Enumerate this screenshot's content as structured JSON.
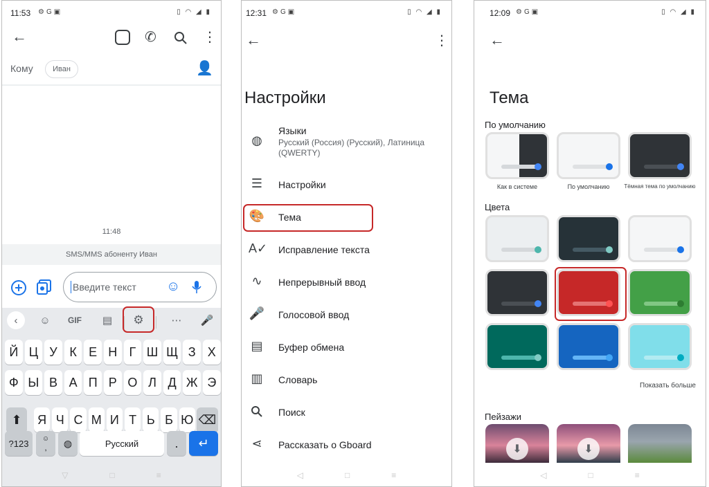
{
  "panel1": {
    "status_time": "11:53",
    "to_label": "Кому",
    "recipient_chip": "Иван",
    "message_time": "11:48",
    "sms_notice": "SMS/MMS абоненту Иван",
    "input_placeholder": "Введите текст",
    "gif_label": "GIF",
    "keyboard_rows": [
      [
        "Й",
        "Ц",
        "У",
        "К",
        "Е",
        "Н",
        "Г",
        "Ш",
        "Щ",
        "З",
        "Х"
      ],
      [
        "Ф",
        "Ы",
        "В",
        "А",
        "П",
        "Р",
        "О",
        "Л",
        "Д",
        "Ж",
        "Э"
      ],
      [
        "Я",
        "Ч",
        "С",
        "М",
        "И",
        "Т",
        "Ь",
        "Б",
        "Ю"
      ]
    ],
    "key_symbols": "?123",
    "key_space": "Русский",
    "key_period": ".",
    "emoji_small": "☺",
    "comma_small": ","
  },
  "panel2": {
    "status_time": "12:31",
    "title": "Настройки",
    "items": [
      {
        "label": "Языки",
        "sub": "Русский (Россия) (Русский), Латиница (QWERTY)",
        "icon": "globe-icon"
      },
      {
        "label": "Настройки",
        "icon": "tune-icon"
      },
      {
        "label": "Тема",
        "icon": "palette-icon"
      },
      {
        "label": "Исправление текста",
        "icon": "spellcheck-icon"
      },
      {
        "label": "Непрерывный ввод",
        "icon": "gesture-icon"
      },
      {
        "label": "Голосовой ввод",
        "icon": "mic-icon"
      },
      {
        "label": "Буфер обмена",
        "icon": "clipboard-icon"
      },
      {
        "label": "Словарь",
        "icon": "dictionary-icon"
      },
      {
        "label": "Поиск",
        "icon": "search-icon"
      },
      {
        "label": "Рассказать о Gboard",
        "icon": "share-icon"
      }
    ]
  },
  "panel3": {
    "status_time": "12:09",
    "title": "Тема",
    "section_default": "По умолчанию",
    "default_themes": [
      {
        "caption": "Как в системе"
      },
      {
        "caption": "По умолчанию"
      },
      {
        "caption": "Тёмная тема по умолчанию"
      }
    ],
    "section_colors": "Цвета",
    "show_more": "Показать больше",
    "section_landscapes": "Пейзажи",
    "color_themes": [
      {
        "bg": "#eceff1",
        "bar": "#d5d8db",
        "dot": "#4db6ac"
      },
      {
        "bg": "#263238",
        "bar": "#455a64",
        "dot": "#80cbc4"
      },
      {
        "bg": "#f5f6f7",
        "bar": "#dfe1e3",
        "dot": "#1a73e8"
      },
      {
        "bg": "#2f3337",
        "bar": "#4a4f54",
        "dot": "#4285f4"
      },
      {
        "bg": "#c62828",
        "bar": "#e57373",
        "dot": "#ff5252"
      },
      {
        "bg": "#43a047",
        "bar": "#81c784",
        "dot": "#2e7d32"
      },
      {
        "bg": "#00695c",
        "bar": "#4db6ac",
        "dot": "#80cbc4"
      },
      {
        "bg": "#1565c0",
        "bar": "#64b5f6",
        "dot": "#42a5f5"
      },
      {
        "bg": "#80deea",
        "bar": "#b2ebf2",
        "dot": "#00acc1"
      }
    ]
  },
  "colors": {
    "highlight": "#c62828",
    "accent": "#1a73e8"
  }
}
